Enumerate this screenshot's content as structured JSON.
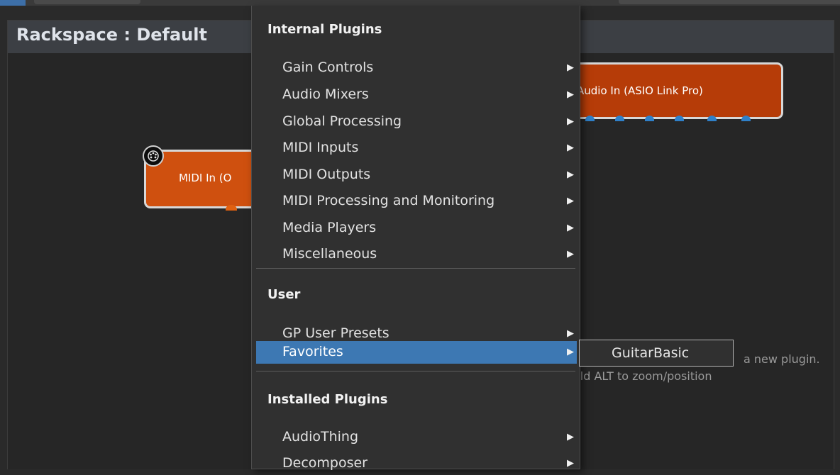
{
  "rackspace": {
    "title": "Rackspace : Default"
  },
  "plugins": {
    "audio_in": {
      "label": "Audio In (ASIO Link Pro)"
    },
    "midi_in": {
      "label": "MIDI In (O"
    }
  },
  "hints": {
    "line1": "a new plugin.",
    "line2": "old ALT to zoom/position"
  },
  "context_menu": {
    "sections": {
      "internal": "Internal Plugins",
      "user": "User",
      "installed": "Installed Plugins"
    },
    "internal_items": [
      "Gain Controls",
      "Audio Mixers",
      "Global Processing",
      "MIDI Inputs",
      "MIDI Outputs",
      "MIDI Processing and Monitoring",
      "Media Players",
      "Miscellaneous"
    ],
    "user_items": [
      "GP User Presets",
      "Favorites"
    ],
    "installed_items": [
      "AudioThing",
      "Decomposer"
    ],
    "selected_item": "Favorites",
    "arrow_glyph": "▶"
  },
  "submenu": {
    "items": [
      "GuitarBasic"
    ]
  },
  "colors": {
    "selection": "#3d78b3",
    "plugin_orange": "#cf500f",
    "plugin_red": "#b63c08",
    "pin_blue": "#2f80c8"
  }
}
